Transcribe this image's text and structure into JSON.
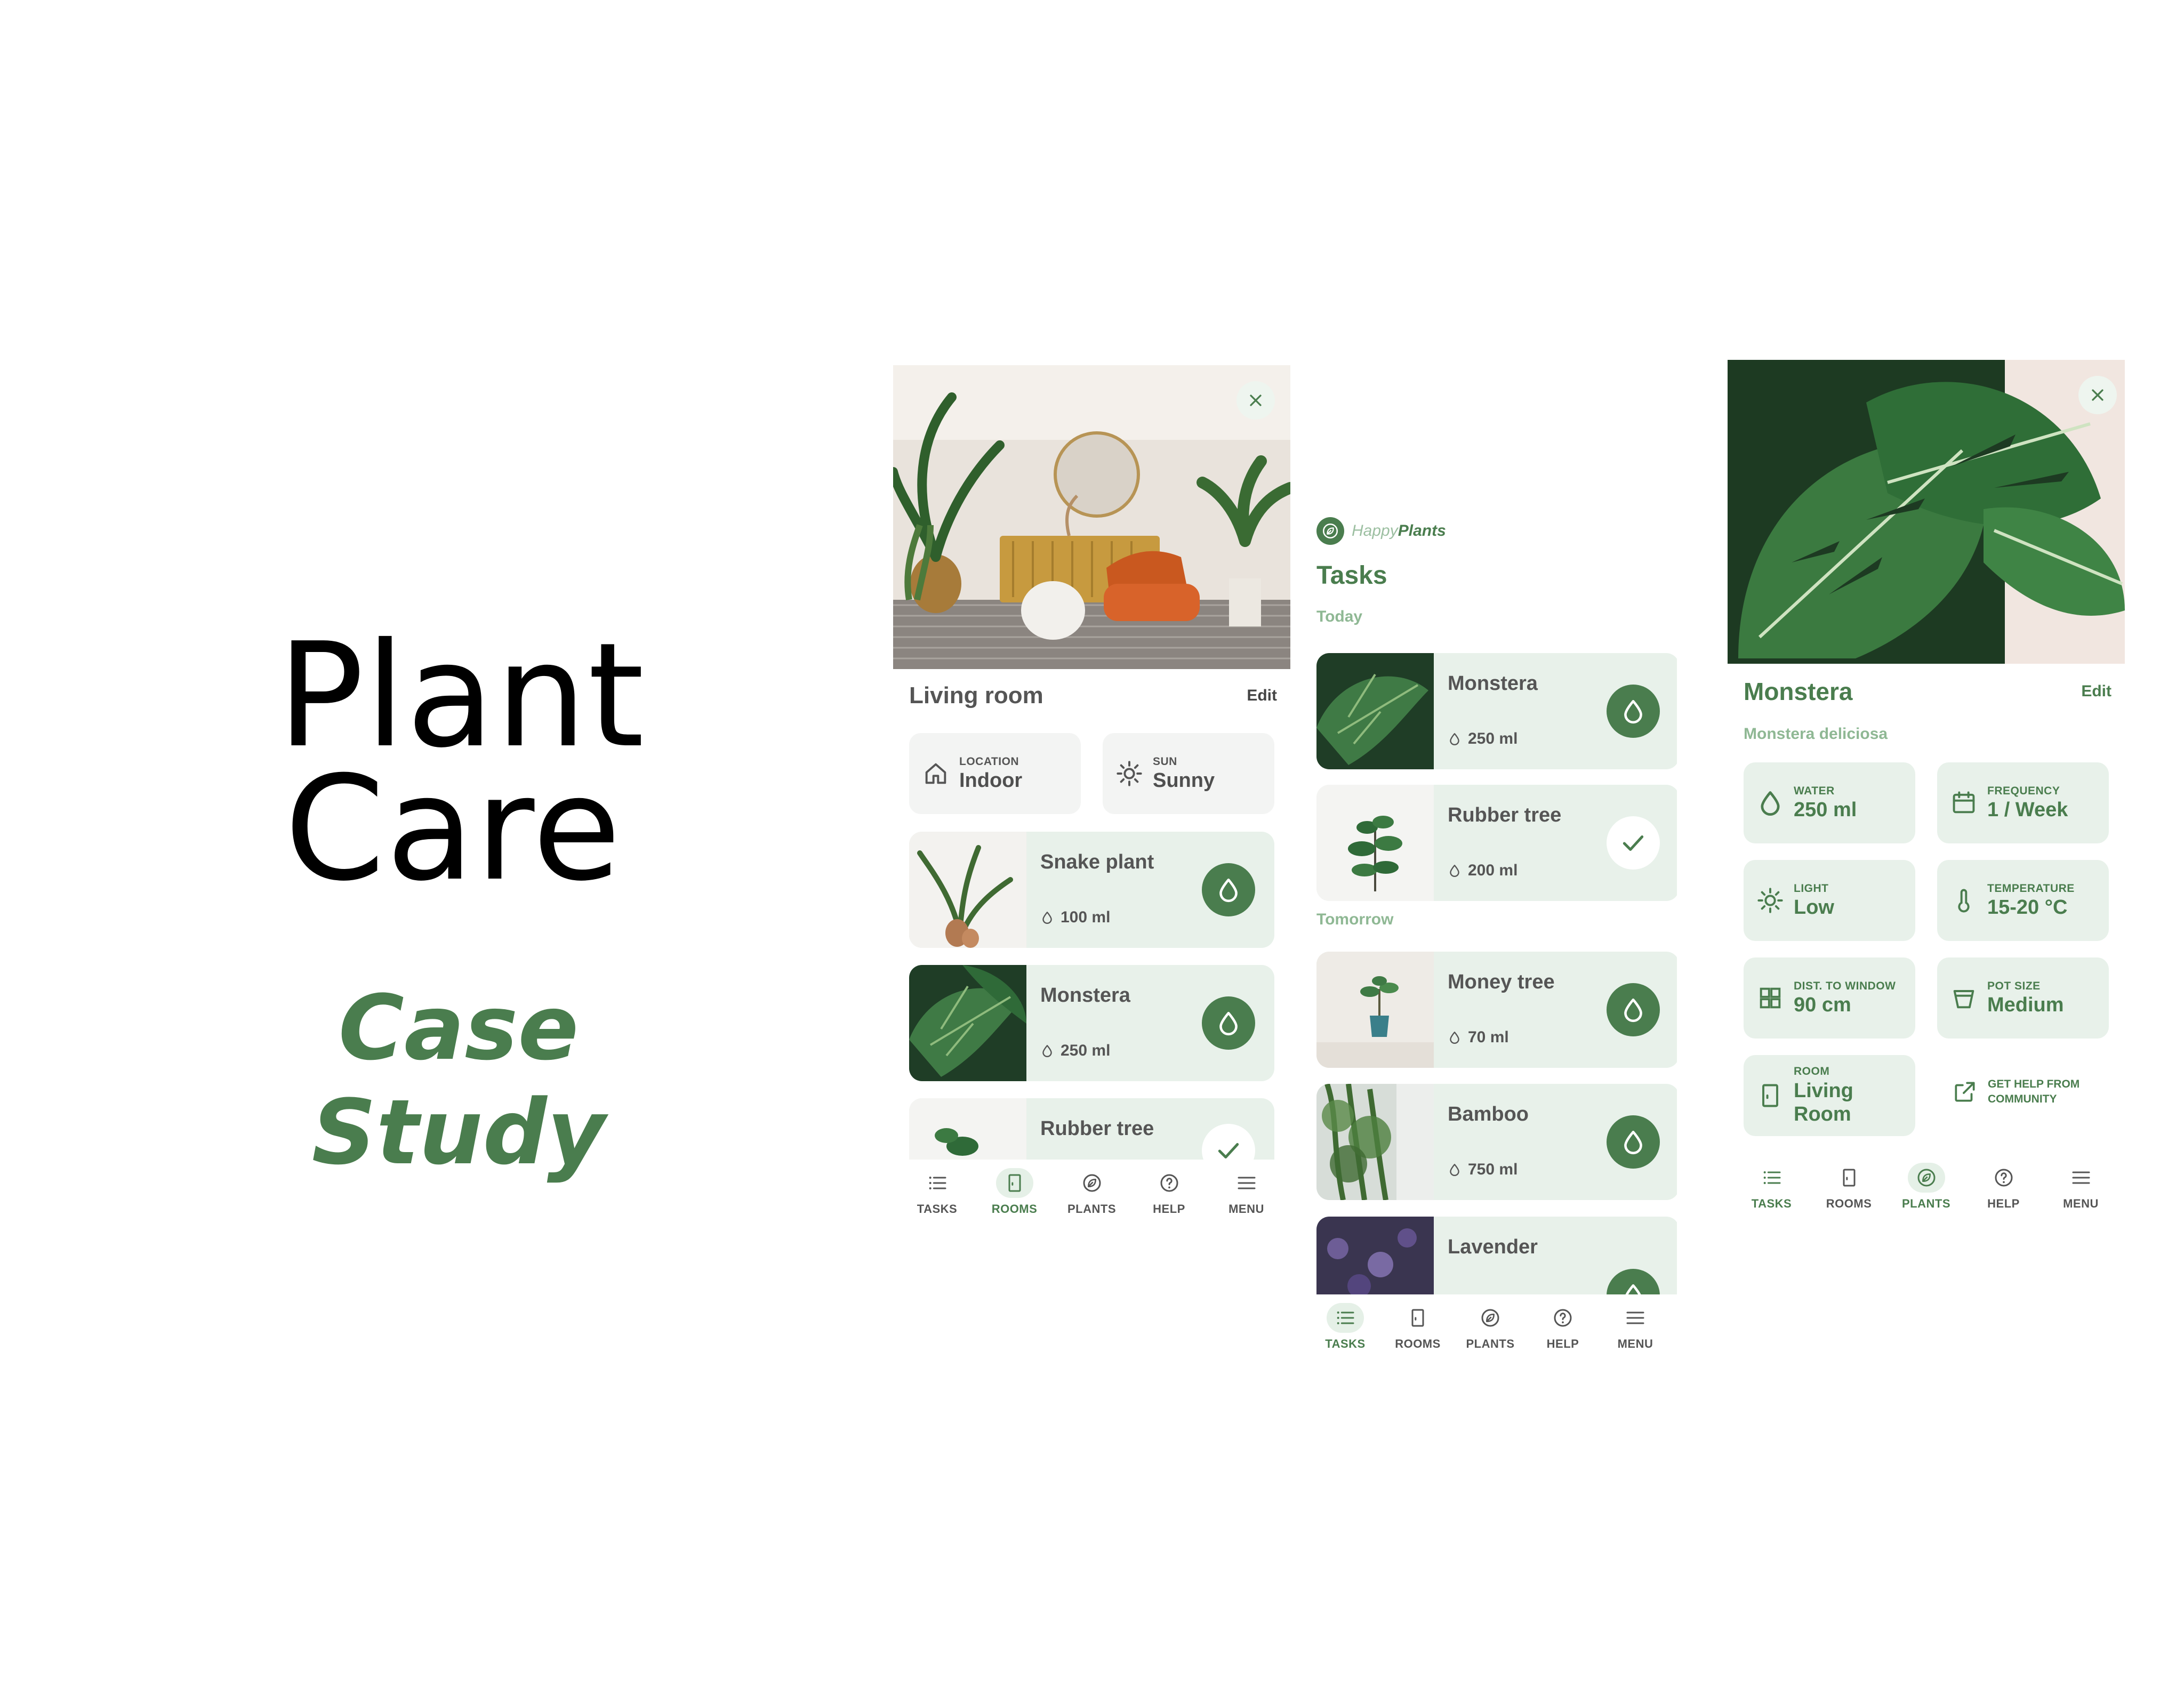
{
  "hero": {
    "title_line1": "Plant",
    "title_line2": "Care",
    "subtitle": "Case Study"
  },
  "colors": {
    "brand_green": "#4a7d4e",
    "light_green": "#e8f1ea",
    "muted_green": "#8fb894"
  },
  "rooms_screen": {
    "title": "Living room",
    "edit": "Edit",
    "chips": [
      {
        "label": "LOCATION",
        "value": "Indoor",
        "icon": "house-icon"
      },
      {
        "label": "SUN",
        "value": "Sunny",
        "icon": "sun-icon"
      }
    ],
    "plants": [
      {
        "name": "Snake plant",
        "amount": "100 ml",
        "action": "water-drop-icon"
      },
      {
        "name": "Monstera",
        "amount": "250 ml",
        "action": "water-drop-icon"
      },
      {
        "name": "Rubber tree",
        "amount": "",
        "action": "check-icon"
      }
    ]
  },
  "tasks_screen": {
    "logo_part1": "Happy",
    "logo_part2": "Plants",
    "title": "Tasks",
    "today_label": "Today",
    "tomorrow_label": "Tomorrow",
    "today": [
      {
        "name": "Monstera",
        "amount": "250 ml",
        "action": "water-drop-icon"
      },
      {
        "name": "Rubber tree",
        "amount": "200 ml",
        "action": "check-icon"
      }
    ],
    "tomorrow": [
      {
        "name": "Money tree",
        "amount": "70 ml",
        "action": "water-drop-icon"
      },
      {
        "name": "Bamboo",
        "amount": "750 ml",
        "action": "water-drop-icon"
      },
      {
        "name": "Lavender",
        "amount": "",
        "action": "water-drop-icon"
      }
    ]
  },
  "plant_screen": {
    "title": "Monstera",
    "edit": "Edit",
    "latin": "Monstera deliciosa",
    "chips": [
      {
        "label": "WATER",
        "value": "250 ml",
        "icon": "water-drop-icon"
      },
      {
        "label": "FREQUENCY",
        "value": "1 / Week",
        "icon": "calendar-icon"
      },
      {
        "label": "LIGHT",
        "value": "Low",
        "icon": "sun-icon"
      },
      {
        "label": "TEMPERATURE",
        "value": "15-20 °C",
        "icon": "thermometer-icon"
      },
      {
        "label": "DIST. TO WINDOW",
        "value": "90 cm",
        "icon": "window-icon"
      },
      {
        "label": "POT SIZE",
        "value": "Medium",
        "icon": "pot-icon"
      },
      {
        "label": "ROOM",
        "value": "Living Room",
        "icon": "door-icon"
      }
    ],
    "community_line1": "GET HELP FROM",
    "community_line2": "COMMUNITY"
  },
  "nav": {
    "tasks": "TASKS",
    "rooms": "ROOMS",
    "plants": "PLANTS",
    "help": "HELP",
    "menu": "MENU"
  }
}
